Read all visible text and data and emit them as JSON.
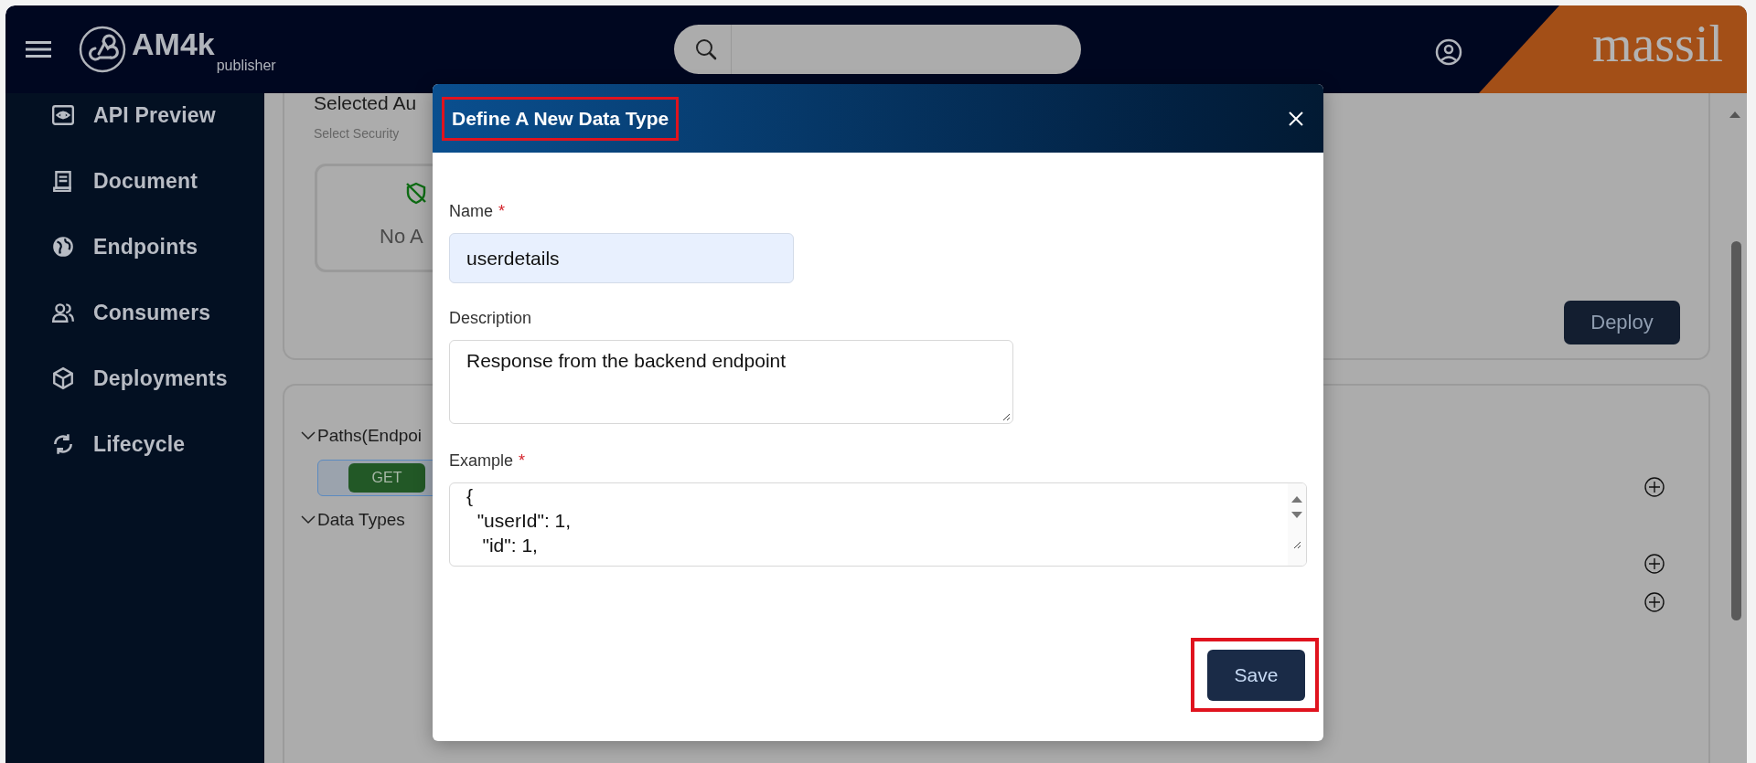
{
  "header": {
    "app_name": "AM4k",
    "app_subtitle": "publisher",
    "brand": "massil"
  },
  "sidebar": {
    "items": [
      {
        "label": "API Preview"
      },
      {
        "label": "Document"
      },
      {
        "label": "Endpoints"
      },
      {
        "label": "Consumers"
      },
      {
        "label": "Deployments"
      },
      {
        "label": "Lifecycle"
      }
    ]
  },
  "auth_card": {
    "title": "Selected Au",
    "subtitle": "Select Security",
    "empty_text": "No A",
    "deploy_button": "Deploy"
  },
  "paths_card": {
    "sections": [
      {
        "label": "Paths(Endpoi",
        "expanded": true
      },
      {
        "label": "Data Types",
        "expanded": true
      }
    ],
    "method": "GET"
  },
  "dialog": {
    "title": "Define A New Data Type",
    "title_highlighted": true,
    "required_mark": "*",
    "fields": [
      {
        "kind": "input",
        "label": "Name",
        "required": true,
        "value": "userdetails"
      },
      {
        "kind": "textarea",
        "label": "Description",
        "required": false,
        "value": "Response from the backend endpoint"
      },
      {
        "kind": "code",
        "label": "Example",
        "required": true,
        "lines": [
          "{",
          "  \"userId\": 1,",
          "   \"id\": 1,"
        ]
      }
    ],
    "save_button": {
      "label": "Save",
      "highlighted": true
    }
  }
}
